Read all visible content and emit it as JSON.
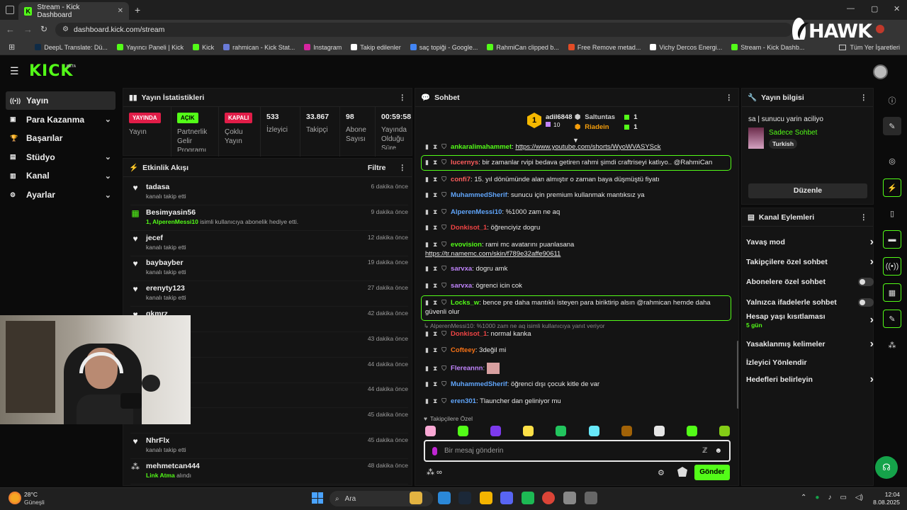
{
  "browser": {
    "tab_title": "Stream - Kick Dashboard",
    "new_tab": "+",
    "url": "dashboard.kick.com/stream",
    "bookmarks": [
      {
        "label": "DeepL Translate: Dü...",
        "color": "#0f2b46"
      },
      {
        "label": "Yayıncı Paneli | Kick",
        "color": "#53fc18"
      },
      {
        "label": "Kick",
        "color": "#53fc18"
      },
      {
        "label": "rahmican - Kick Stat...",
        "color": "#6a7bd8"
      },
      {
        "label": "Instagram",
        "color": "#d6249f"
      },
      {
        "label": "Takip edilenler",
        "color": "#ffffff"
      },
      {
        "label": "saç topiği - Google...",
        "color": "#4285f4"
      },
      {
        "label": "RahmiCan clipped b...",
        "color": "#53fc18"
      },
      {
        "label": "Free Remove metad...",
        "color": "#e34c26"
      },
      {
        "label": "Vichy Dercos Energi...",
        "color": "#ffffff"
      },
      {
        "label": "Stream - Kick Dashb...",
        "color": "#53fc18"
      }
    ],
    "all_bookmarks": "Tüm Yer İşaretleri",
    "overlay_logo": "HAWK"
  },
  "kick": {
    "logo": "KICK",
    "beta": "BETA",
    "sidebar": [
      {
        "label": "Yayın",
        "icon": "broadcast-icon",
        "glyph": "((•))",
        "chev": ""
      },
      {
        "label": "Para Kazanma",
        "icon": "money-icon",
        "glyph": "▣",
        "chev": "⌄"
      },
      {
        "label": "Başarılar",
        "icon": "trophy-icon",
        "glyph": "🏆",
        "chev": ""
      },
      {
        "label": "Stüdyo",
        "icon": "studio-icon",
        "glyph": "▤",
        "chev": "⌄"
      },
      {
        "label": "Kanal",
        "icon": "channel-icon",
        "glyph": "▥",
        "chev": "⌄"
      },
      {
        "label": "Ayarlar",
        "icon": "settings-icon",
        "glyph": "⚙",
        "chev": "⌄"
      }
    ]
  },
  "stats": {
    "title": "Yayın İstatistikleri",
    "items": [
      {
        "badge": "YAYINDA",
        "badge_color": "#e11d48",
        "label": "Yayın"
      },
      {
        "badge": "AÇIK",
        "badge_color": "#53fc18",
        "label": "Partnerlik Gelir Programı"
      },
      {
        "badge": "KAPALI",
        "badge_color": "#e11d48",
        "label": "Çoklu Yayın"
      },
      {
        "value": "533",
        "label": "İzleyici"
      },
      {
        "value": "33.867",
        "label": "Takipçi"
      },
      {
        "value": "98",
        "label": "Abone Sayısı"
      },
      {
        "value": "00:59:58",
        "label": "Yayında Olduğu Süre"
      }
    ]
  },
  "activity": {
    "title": "Etkinlik Akışı",
    "filter": "Filtre",
    "items": [
      {
        "name": "tadasa",
        "sub": "kanalı takip etti",
        "time": "6 dakika önce",
        "icon": "heart"
      },
      {
        "name": "Besimyasin56",
        "sub_highlight": "1, AlperenMessi10",
        "sub": " isimli kullanıcıya abonelik hediye etti.",
        "time": "9 dakika önce",
        "icon": "gift"
      },
      {
        "name": "jecef",
        "sub": "kanalı takip etti",
        "time": "12 dakika önce",
        "icon": "heart"
      },
      {
        "name": "baybayber",
        "sub": "kanalı takip etti",
        "time": "19 dakika önce",
        "icon": "heart"
      },
      {
        "name": "erenyty123",
        "sub": "kanalı takip etti",
        "time": "27 dakika önce",
        "icon": "heart"
      },
      {
        "name": "gkmrz",
        "sub": "kanalı takip etti",
        "time": "42 dakika önce",
        "icon": "heart"
      },
      {
        "name": "",
        "sub": "",
        "time": "43 dakika önce",
        "icon": "heart"
      },
      {
        "name": "",
        "sub": "",
        "time": "44 dakika önce",
        "icon": "heart"
      },
      {
        "name": "",
        "sub": "",
        "time": "44 dakika önce",
        "icon": "heart"
      },
      {
        "name": "",
        "sub": "kanalı takip etti",
        "time": "45 dakika önce",
        "icon": "heart"
      },
      {
        "name": "NhrFlx",
        "sub": "kanalı takip etti",
        "time": "45 dakika önce",
        "icon": "heart"
      },
      {
        "name": "mehmetcan444",
        "sub_highlight": "Link Atma",
        "sub": " alındı",
        "time": "48 dakika önce",
        "icon": "dots"
      }
    ]
  },
  "chat": {
    "title": "Sohbet",
    "leader": {
      "rank": "1",
      "name": "adil6848",
      "count": "10"
    },
    "top": [
      {
        "name": "Saltuntas",
        "count": "1",
        "color": "#cccccc"
      },
      {
        "name": "Riadein",
        "count": "1",
        "color": "#f59e0b"
      }
    ],
    "messages": [
      {
        "user": "ankaralimahammet",
        "color": "#53fc18",
        "text": "https://www.youtube.com/shorts/WyoWVASYSck",
        "link": true
      },
      {
        "user": "lucernys",
        "color": "#ff5d5d",
        "text": "bir zamanlar rvipi bedava getiren rahmi şimdi craftriseyi katlıyo.. @RahmiCan"
      },
      {
        "user": "confi7",
        "color": "#ff5d5d",
        "text": "15. yıl dönümünde alan almıştır o zaman baya düşmüştü fiyatı"
      },
      {
        "user": "MuhammedSherif",
        "color": "#60a5fa",
        "text": "sunucu için premium kullanmak mantıksız ya"
      },
      {
        "user": "AlperenMessi10",
        "color": "#60a5fa",
        "text": "%1000 zam ne aq"
      },
      {
        "user": "Donkisot_1",
        "color": "#ef4444",
        "text": "öğrenciyiz dogru"
      },
      {
        "user": "evovision",
        "color": "#53fc18",
        "text": "rami mc avatarını puanlasana",
        "text2": "https://tr.namemc.com/skin/f789e32affe90611"
      },
      {
        "user": "sarvxa",
        "color": "#c084fc",
        "text": "dogru amk"
      },
      {
        "user": "sarvxa",
        "color": "#c084fc",
        "text": "ögrenci icin cok"
      },
      {
        "user": "Locks_w",
        "color": "#53fc18",
        "text": "bence pre daha mantıklı isteyen para biriktirip alsın @rahmican hemde daha",
        "text2": "güvenli olur"
      },
      {
        "reply": "AlperenMessi10: %1000 zam ne aq isimli kullanıcıya yanıt veriyor"
      },
      {
        "user": "Donkisot_1",
        "color": "#ef4444",
        "text": "normal kanka"
      },
      {
        "user": "Cofteey",
        "color": "#f97316",
        "text": "3değil mi"
      },
      {
        "user": "Flereannn",
        "color": "#c084fc",
        "text": ""
      },
      {
        "user": "MuhammedSherif",
        "color": "#60a5fa",
        "text": "öğrenci dışı çocuk kitle de var"
      },
      {
        "user": "eren301",
        "color": "#60a5fa",
        "text": "Tlauncher dan geliniyor mu"
      }
    ],
    "followers_only": "Takipçilere Özel",
    "placeholder": "Bir mesaj gönderin",
    "send": "Gönder"
  },
  "stream_info": {
    "title": "Yayın bilgisi",
    "stream_title": "sa | sunucu yarin aciliyo",
    "category": "Sadece Sohbet",
    "tag": "Turkish",
    "edit": "Düzenle"
  },
  "channel_actions": {
    "title": "Kanal Eylemleri",
    "items": [
      {
        "label": "Yavaş mod",
        "type": "arrow"
      },
      {
        "label": "Takipçilere özel sohbet",
        "type": "arrow"
      },
      {
        "label": "Abonelere özel sohbet",
        "type": "toggle"
      },
      {
        "label": "Yalnızca ifadelerle sohbet",
        "type": "toggle"
      },
      {
        "label": "Hesap yaşı kısıtlaması",
        "sub": "5 gün",
        "type": "arrow"
      },
      {
        "label": "Yasaklanmış kelimeler",
        "type": "arrow"
      },
      {
        "label": "İzleyici Yönlendir",
        "type": "none"
      },
      {
        "label": "Hedefleri belirleyin",
        "type": "arrow"
      }
    ]
  },
  "taskbar": {
    "weather_temp": "28°C",
    "weather_desc": "Güneşli",
    "search": "Ara",
    "time": "12:04",
    "date": "8.08.2025"
  }
}
